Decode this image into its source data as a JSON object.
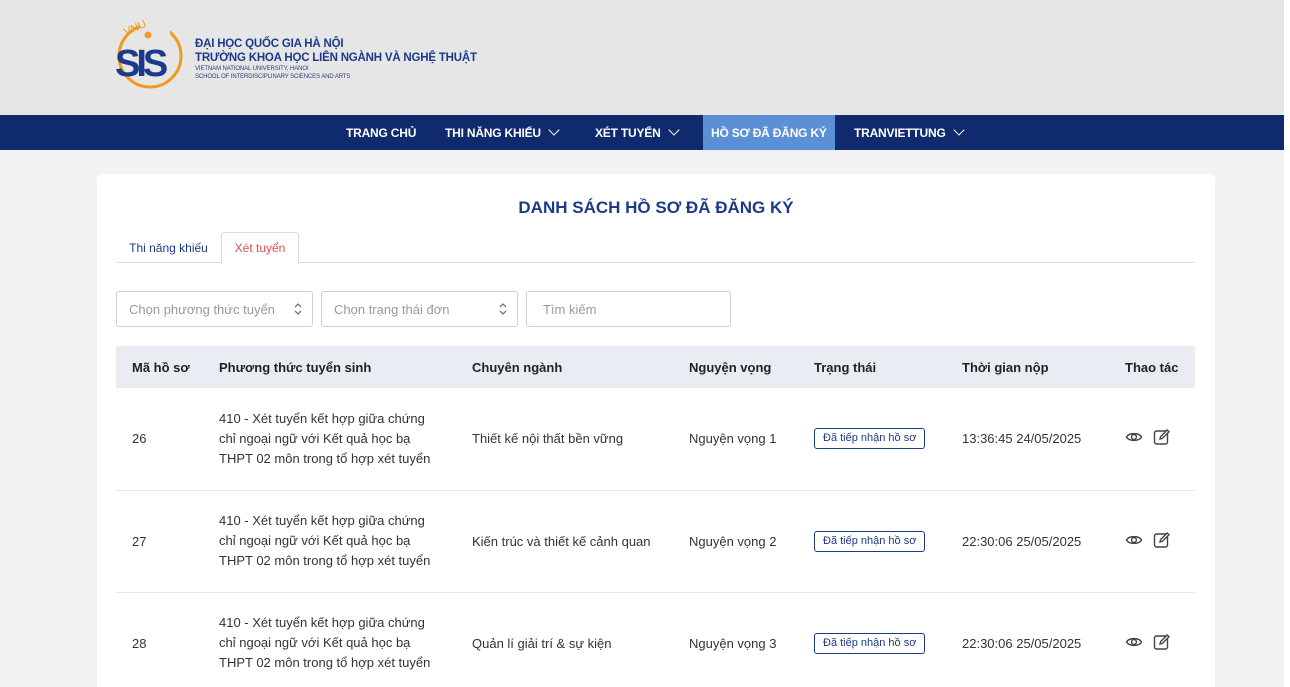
{
  "brand": {
    "line1": "ĐẠI HỌC QUỐC GIA HÀ NỘI",
    "line2": "TRƯỜNG KHOA HỌC LIÊN NGÀNH VÀ NGHỆ THUẬT",
    "line3": "VIETNAM NATIONAL UNIVERSITY, HANOI",
    "line4": "SCHOOL OF INTERDISCIPLINARY SCIENCES AND ARTS",
    "logo_small": "VNU",
    "logo_main": "SIS"
  },
  "nav": {
    "home": "TRANG CHỦ",
    "talent": "THI NĂNG KHIẾU",
    "admission": "XÉT TUYỂN",
    "registered": "HỒ SƠ ĐÃ ĐĂNG KÝ",
    "user": "TRANVIETTUNG"
  },
  "page_title": "DANH SÁCH HỒ SƠ ĐÃ ĐĂNG KÝ",
  "tabs": [
    "Thi năng khiếu",
    "Xét tuyển"
  ],
  "filters": {
    "method_placeholder": "Chọn phương thức tuyển",
    "status_placeholder": "Chọn trạng thái đơn",
    "search_placeholder": "Tìm kiếm"
  },
  "table": {
    "headers": [
      "Mã hồ sơ",
      "Phương thức tuyển sinh",
      "Chuyên ngành",
      "Nguyện vọng",
      "Trạng thái",
      "Thời gian nộp",
      "Thao tác"
    ],
    "rows": [
      {
        "id": "26",
        "method": "410 - Xét tuyển kết hợp giữa chứng chỉ ngoại ngữ với Kết quả học bạ THPT 02 môn trong tổ hợp xét tuyển",
        "major": "Thiết kế nội thất bền vững",
        "wish": "Nguyện vọng 1",
        "status": "Đã tiếp nhận hồ sơ",
        "time": "13:36:45 24/05/2025"
      },
      {
        "id": "27",
        "method": "410 - Xét tuyển kết hợp giữa chứng chỉ ngoại ngữ với Kết quả học bạ THPT 02 môn trong tổ hợp xét tuyển",
        "major": "Kiến trúc và thiết kế cảnh quan",
        "wish": "Nguyện vọng 2",
        "status": "Đã tiếp nhận hồ sơ",
        "time": "22:30:06 25/05/2025"
      },
      {
        "id": "28",
        "method": "410 - Xét tuyển kết hợp giữa chứng chỉ ngoại ngữ với Kết quả học bạ THPT 02 môn trong tổ hợp xét tuyển",
        "major": "Quản lí giải trí & sự kiện",
        "wish": "Nguyện vọng 3",
        "status": "Đã tiếp nhận hồ sơ",
        "time": "22:30:06 25/05/2025"
      }
    ]
  },
  "icons": {
    "view": "eye-icon",
    "edit": "edit-icon"
  },
  "colors": {
    "nav_bg": "#0f2b6e",
    "active_nav": "#5b8fd6",
    "title": "#1c3a86",
    "active_tab": "#e24c4c",
    "logo_orange": "#f39a1e"
  }
}
